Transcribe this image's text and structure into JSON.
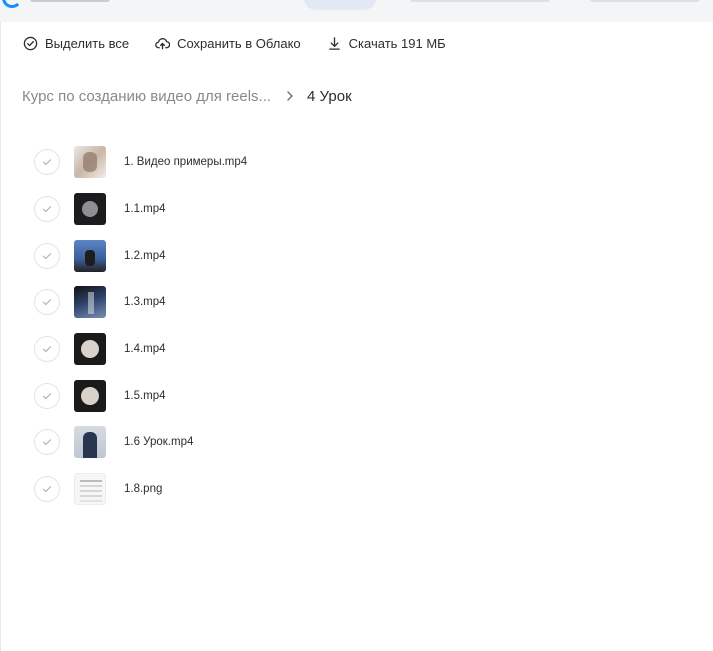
{
  "toolbar": {
    "select_all_label": "Выделить все",
    "save_to_cloud_label": "Сохранить в Облако",
    "download_label": "Скачать 191 МБ"
  },
  "breadcrumb": {
    "parent": "Курс по созданию видео для reels...",
    "current": "4 Урок"
  },
  "files": [
    {
      "name": "1. Видео примеры.mp4",
      "thumb": "video-thumbnail"
    },
    {
      "name": "1.1.mp4",
      "thumb": "video-thumbnail"
    },
    {
      "name": "1.2.mp4",
      "thumb": "video-thumbnail"
    },
    {
      "name": "1.3.mp4",
      "thumb": "video-thumbnail"
    },
    {
      "name": "1.4.mp4",
      "thumb": "video-thumbnail"
    },
    {
      "name": "1.5.mp4",
      "thumb": "video-thumbnail"
    },
    {
      "name": "1.6 Урок.mp4",
      "thumb": "video-thumbnail"
    },
    {
      "name": "1.8.png",
      "thumb": "image-thumbnail"
    }
  ],
  "colors": {
    "text": "#2c2d2e",
    "muted": "#87898f",
    "accent": "#1a8cff",
    "check_border": "#e3e4e8"
  }
}
